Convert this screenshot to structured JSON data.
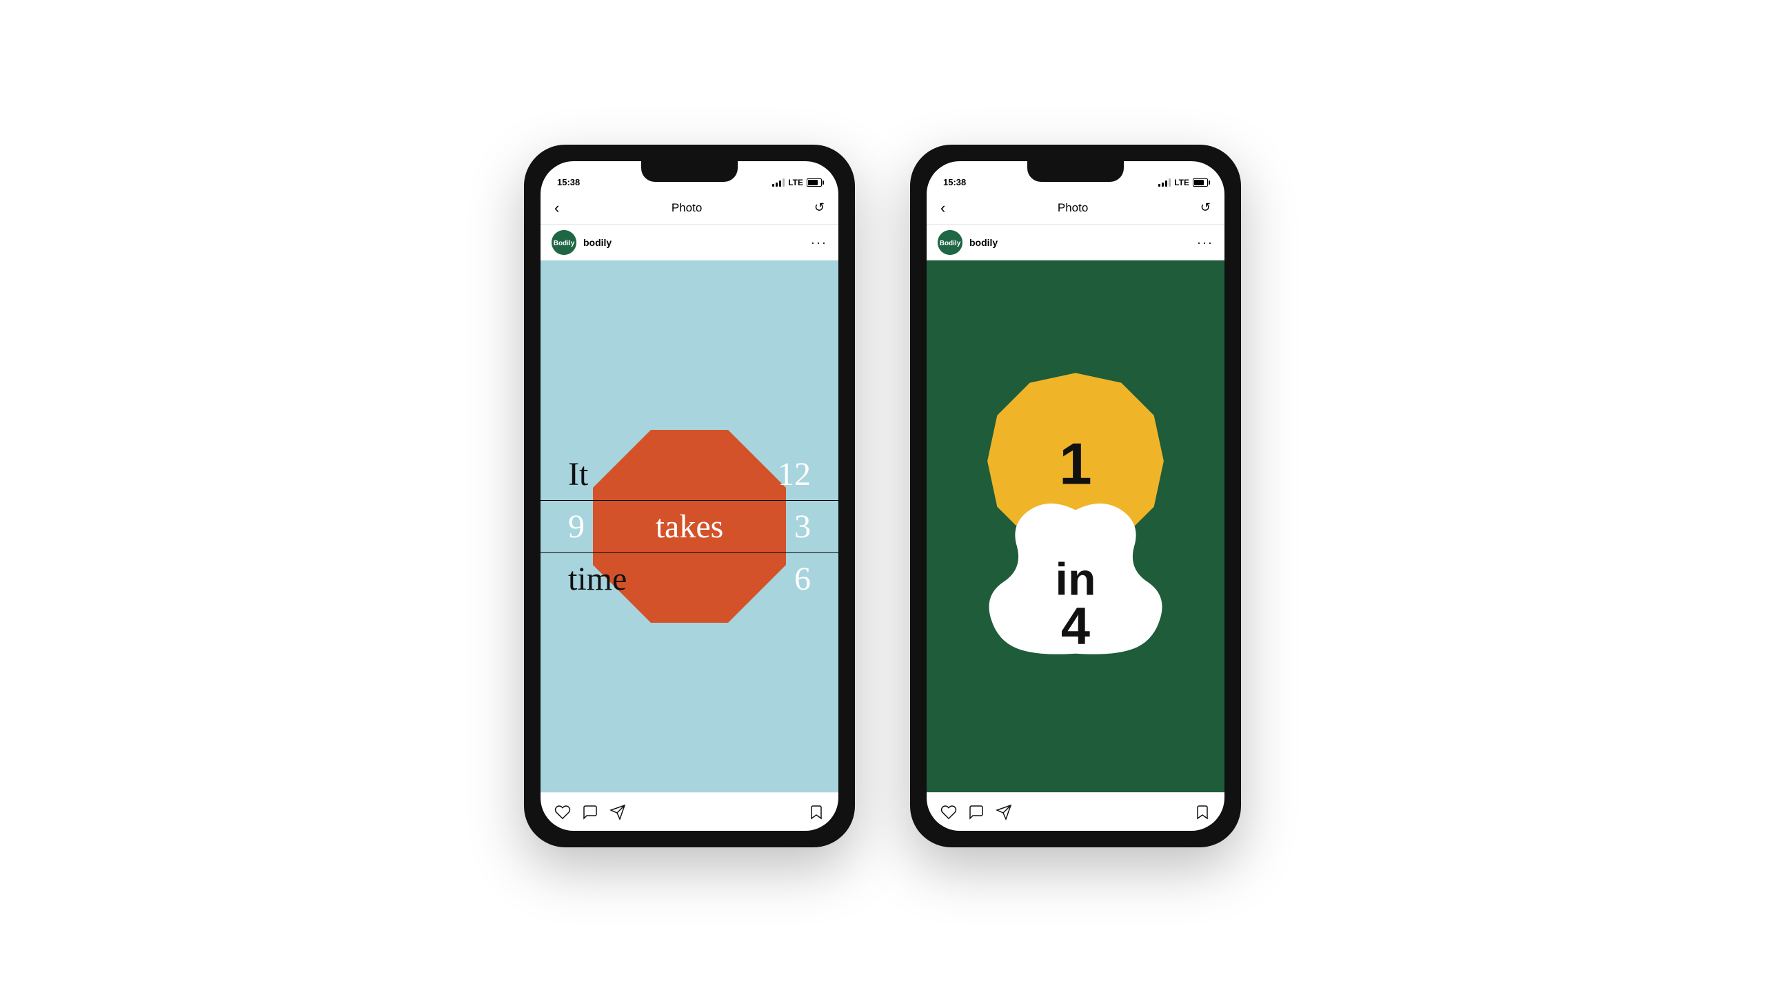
{
  "page": {
    "background": "#ffffff"
  },
  "phones": [
    {
      "id": "phone-1",
      "status": {
        "time": "15:38",
        "signal": "LTE"
      },
      "nav": {
        "back": "<",
        "title": "Photo",
        "refresh": "↺"
      },
      "post": {
        "avatar_text": "Bodily",
        "username": "bodily",
        "more": "..."
      },
      "image": {
        "type": "clock",
        "bg_color": "#a8d4de",
        "shape_color": "#d4522a",
        "texts": {
          "it": "It",
          "twelve": "12",
          "nine": "9",
          "takes": "takes",
          "three": "3",
          "time": "time",
          "six": "6"
        }
      },
      "actions": [
        "heart",
        "comment",
        "share",
        "bookmark"
      ]
    },
    {
      "id": "phone-2",
      "status": {
        "time": "15:38",
        "signal": "LTE"
      },
      "nav": {
        "back": "<",
        "title": "Photo",
        "refresh": "↺"
      },
      "post": {
        "avatar_text": "Bodily",
        "username": "bodily",
        "more": "..."
      },
      "image": {
        "type": "flower",
        "bg_color": "#1e5c3a",
        "yellow_color": "#f0b429",
        "white_color": "#ffffff",
        "texts": {
          "one": "1",
          "in": "in",
          "four": "4"
        }
      },
      "actions": [
        "heart",
        "comment",
        "share",
        "bookmark"
      ]
    }
  ]
}
